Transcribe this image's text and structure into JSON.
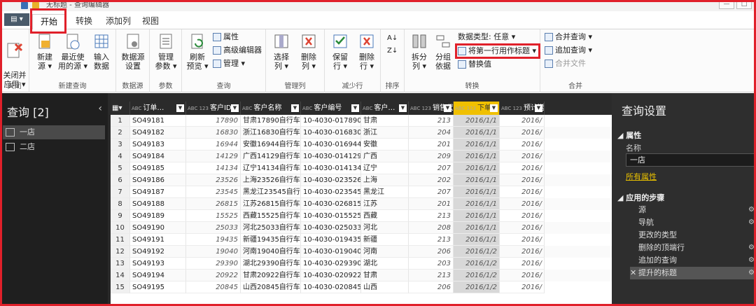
{
  "window": {
    "title": "无标题 - 查询编辑器"
  },
  "tabs": {
    "file": "▤ ▾",
    "home": "开始",
    "transform": "转换",
    "add_column": "添加列",
    "view": "视图"
  },
  "ribbon": {
    "close_apply": "关闭并\n应用 ▾",
    "group_close": "关闭",
    "new_source": "新建\n源 ▾",
    "recent_sources": "最近使\n用的源 ▾",
    "enter_data": "输入\n数据",
    "group_new_query": "新建查询",
    "data_source_settings": "数据源\n设置",
    "group_data_sources": "数据源",
    "manage_params": "管理\n参数 ▾",
    "group_params": "参数",
    "refresh_preview": "刷新\n预览 ▾",
    "properties": "属性",
    "advanced_editor": "高级编辑器",
    "manage": "管理 ▾",
    "group_query": "查询",
    "choose_columns": "选择\n列 ▾",
    "remove_columns": "删除\n列 ▾",
    "group_manage_columns": "管理列",
    "keep_rows": "保留\n行 ▾",
    "remove_rows": "删除\n行 ▾",
    "group_reduce_rows": "减少行",
    "group_sort": "排序",
    "split_column": "拆分\n列 ▾",
    "group_by": "分组\n依据",
    "data_type": "数据类型: 任意 ▾",
    "use_first_row": "将第一行用作标题 ▾",
    "replace_values": "替换值",
    "group_transform": "转换",
    "merge_queries": "合并查询 ▾",
    "append_queries": "追加查询 ▾",
    "combine_files": "合并文件",
    "group_combine": "合并"
  },
  "queries": {
    "title": "查询 [2]",
    "items": [
      "一店",
      "二店"
    ]
  },
  "grid": {
    "columns": [
      {
        "type": "ABC",
        "name": "订单…"
      },
      {
        "type": "ABC 123",
        "name": "客户ID"
      },
      {
        "type": "ABC",
        "name": "客户名称"
      },
      {
        "type": "ABC",
        "name": "客户编号"
      },
      {
        "type": "ABC",
        "name": "客户…"
      },
      {
        "type": "ABC 123",
        "name": "销售代…"
      },
      {
        "type": "ABC 123",
        "name": "下单…"
      },
      {
        "type": "ABC 123",
        "name": "预计送…"
      }
    ],
    "rows": [
      [
        "1",
        "SO49181",
        "17890",
        "甘肃17890自行车…",
        "10-4030-017890",
        "甘肃",
        "213",
        "2016/1/1",
        "2016/"
      ],
      [
        "2",
        "SO49182",
        "16830",
        "浙江16830自行车…",
        "10-4030-016830",
        "浙江",
        "204",
        "2016/1/1",
        "2016/"
      ],
      [
        "3",
        "SO49183",
        "16944",
        "安徽16944自行车…",
        "10-4030-016944",
        "安徽",
        "201",
        "2016/1/1",
        "2016/"
      ],
      [
        "4",
        "SO49184",
        "14129",
        "广西14129自行车…",
        "10-4030-014129",
        "广西",
        "209",
        "2016/1/1",
        "2016/"
      ],
      [
        "5",
        "SO49185",
        "14134",
        "辽宁14134自行车…",
        "10-4030-014134",
        "辽宁",
        "207",
        "2016/1/1",
        "2016/"
      ],
      [
        "6",
        "SO49186",
        "23526",
        "上海23526自行车…",
        "10-4030-023526",
        "上海",
        "202",
        "2016/1/1",
        "2016/"
      ],
      [
        "7",
        "SO49187",
        "23545",
        "黑龙江23545自行车…",
        "10-4030-023545",
        "黑龙江",
        "207",
        "2016/1/1",
        "2016/"
      ],
      [
        "8",
        "SO49188",
        "26815",
        "江苏26815自行车…",
        "10-4030-026815",
        "江苏",
        "201",
        "2016/1/1",
        "2016/"
      ],
      [
        "9",
        "SO49189",
        "15525",
        "西藏15525自行车…",
        "10-4030-015525",
        "西藏",
        "213",
        "2016/1/1",
        "2016/"
      ],
      [
        "10",
        "SO49190",
        "25033",
        "河北25033自行车…",
        "10-4030-025033",
        "河北",
        "208",
        "2016/1/1",
        "2016/"
      ],
      [
        "11",
        "SO49191",
        "19435",
        "新疆19435自行车…",
        "10-4030-019435",
        "新疆",
        "213",
        "2016/1/1",
        "2016/"
      ],
      [
        "12",
        "SO49192",
        "19040",
        "河南19040自行车…",
        "10-4030-019040",
        "河南",
        "206",
        "2016/1/2",
        "2016/"
      ],
      [
        "13",
        "SO49193",
        "29390",
        "湖北29390自行车…",
        "10-4030-029390",
        "湖北",
        "203",
        "2016/1/2",
        "2016/"
      ],
      [
        "14",
        "SO49194",
        "20922",
        "甘肃20922自行车…",
        "10-4030-020922",
        "甘肃",
        "213",
        "2016/1/2",
        "2016/"
      ],
      [
        "15",
        "SO49195",
        "20845",
        "山西20845自行车…",
        "10-4030-020845",
        "山西",
        "206",
        "2016/1/2",
        "2016/"
      ]
    ]
  },
  "settings": {
    "title": "查询设置",
    "properties": "属性",
    "name_label": "名称",
    "name_value": "一店",
    "all_properties": "所有属性",
    "applied_steps": "应用的步骤",
    "steps": [
      "源",
      "导航",
      "更改的类型",
      "删除的顶端行",
      "追加的查询",
      "提升的标题"
    ]
  }
}
